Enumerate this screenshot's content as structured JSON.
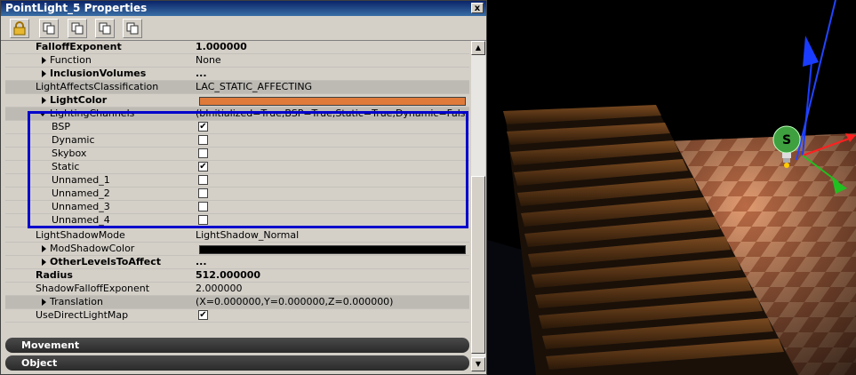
{
  "window": {
    "title": "PointLight_5 Properties",
    "close_glyph": "x"
  },
  "toolbar": {
    "lock_icon": "lock-icon",
    "copy_icons": [
      "copy-icon",
      "copy-icon",
      "copy-icon",
      "copy-icon"
    ]
  },
  "props": {
    "falloffexponent": {
      "name": "FalloffExponent",
      "value": "1.000000"
    },
    "function": {
      "name": "Function",
      "value": "None"
    },
    "inclusionvolumes": {
      "name": "InclusionVolumes",
      "value": "..."
    },
    "lightaffectsclassification": {
      "name": "LightAffectsClassification",
      "value": "LAC_STATIC_AFFECTING"
    },
    "lightcolor": {
      "name": "LightColor",
      "swatch": "#e07a3a"
    },
    "lightingchannels": {
      "name": "LightingChannels",
      "value": "(bInitialized=True,BSP=True,Static=True,Dynamic=False,Skybox=False,Unnamed_1=False,Unnamed_2=False,Unnamed_3=False,Unnamed_4=False)"
    },
    "bsp": {
      "name": "BSP",
      "checked": true
    },
    "dynamic": {
      "name": "Dynamic",
      "checked": false
    },
    "skybox": {
      "name": "Skybox",
      "checked": false
    },
    "static": {
      "name": "Static",
      "checked": true
    },
    "unnamed_1": {
      "name": "Unnamed_1",
      "checked": false
    },
    "unnamed_2": {
      "name": "Unnamed_2",
      "checked": false
    },
    "unnamed_3": {
      "name": "Unnamed_3",
      "checked": false
    },
    "unnamed_4": {
      "name": "Unnamed_4",
      "checked": false
    },
    "lightshadowmode": {
      "name": "LightShadowMode",
      "value": "LightShadow_Normal"
    },
    "modshadowcolor": {
      "name": "ModShadowColor",
      "swatch": "#000000"
    },
    "otherlevelstoaffect": {
      "name": "OtherLevelsToAffect",
      "value": "..."
    },
    "radius": {
      "name": "Radius",
      "value": "512.000000"
    },
    "shadowfalloffexponent": {
      "name": "ShadowFalloffExponent",
      "value": "2.000000"
    },
    "translation": {
      "name": "Translation",
      "value": "(X=0.000000,Y=0.000000,Z=0.000000)"
    },
    "usedirectlightmap": {
      "name": "UseDirectLightMap",
      "checked": true
    }
  },
  "sections": {
    "movement": "Movement",
    "object": "Object"
  },
  "viewport": {
    "light_label": "S"
  },
  "colors": {
    "highlight": "#0000cc",
    "title_bar": "#0a246a",
    "gizmo_blue": "#1a3cff",
    "gizmo_red": "#ff2020",
    "gizmo_green": "#20c020"
  }
}
